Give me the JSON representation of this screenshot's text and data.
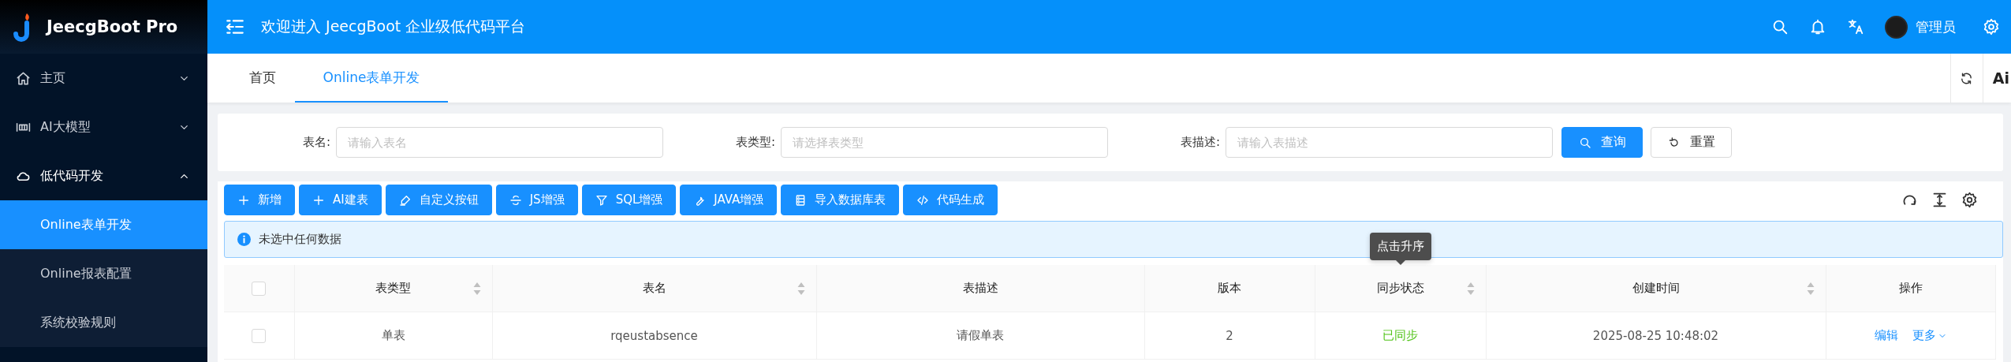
{
  "sidebar": {
    "logo_text": "JeecgBoot Pro",
    "menu": [
      {
        "label": "主页",
        "expanded": false
      },
      {
        "label": "AI大模型",
        "expanded": false
      },
      {
        "label": "低代码开发",
        "expanded": true,
        "children": [
          {
            "label": "Online表单开发",
            "selected": true
          },
          {
            "label": "Online报表配置",
            "selected": false
          },
          {
            "label": "系统校验规则",
            "selected": false
          }
        ]
      }
    ]
  },
  "header": {
    "title": "欢迎进入 JeecgBoot 企业级低代码平台",
    "user": "管理员"
  },
  "tabs": [
    {
      "label": "首页",
      "selected": false
    },
    {
      "label": "Online表单开发",
      "selected": true
    }
  ],
  "tab_bar_extra": "Ai",
  "search": {
    "fields": [
      {
        "label": "表名:",
        "placeholder": "请输入表名"
      },
      {
        "label": "表类型:",
        "placeholder": "请选择表类型"
      },
      {
        "label": "表描述:",
        "placeholder": "请输入表描述"
      }
    ],
    "buttons": [
      {
        "label": "查询",
        "kind": "primary"
      },
      {
        "label": "重置",
        "kind": "default"
      }
    ]
  },
  "toolbar": {
    "buttons": [
      "新增",
      "AI建表",
      "自定义按钮",
      "JS增强",
      "SQL增强",
      "JAVA增强",
      "导入数据库表",
      "代码生成"
    ]
  },
  "alert": "未选中任何数据",
  "table": {
    "select_all_checked": false,
    "columns": [
      {
        "label": "表类型",
        "sortable": true
      },
      {
        "label": "表名",
        "sortable": true
      },
      {
        "label": "表描述",
        "sortable": false
      },
      {
        "label": "版本",
        "sortable": false
      },
      {
        "label": "同步状态",
        "sortable": true,
        "tooltip": "点击升序"
      },
      {
        "label": "创建时间",
        "sortable": true
      },
      {
        "label": "操作",
        "sortable": false
      }
    ],
    "rows": [
      {
        "checked": false,
        "type": "单表",
        "name": "rqeustabsence",
        "description": "请假单表",
        "version": "2",
        "sync_status": "已同步",
        "synced": true,
        "created": "2025-08-25 10:48:02",
        "actions": [
          "编辑",
          "更多"
        ]
      }
    ]
  }
}
